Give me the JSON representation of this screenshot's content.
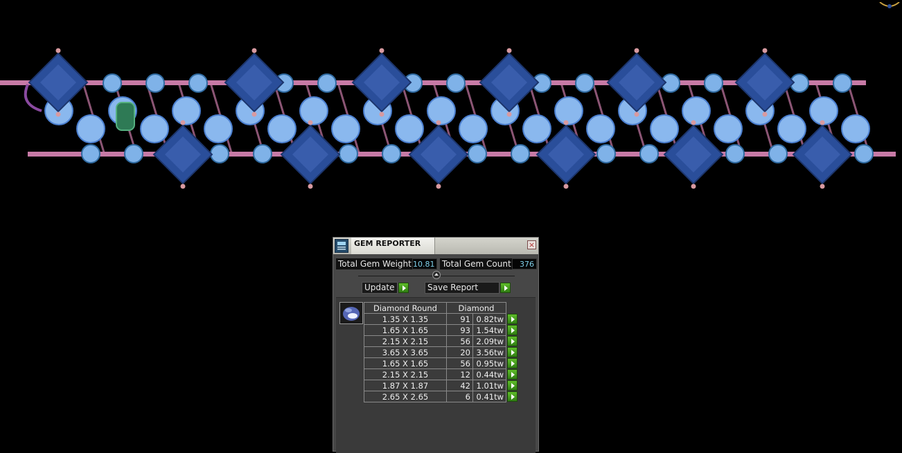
{
  "window": {
    "title": "GEM REPORTER"
  },
  "summary": {
    "total_weight_label": "Total Gem Weight",
    "total_weight_value": "10.81",
    "total_count_label": "Total Gem Count",
    "total_count_value": "376"
  },
  "actions": {
    "update_label": "Update",
    "save_report_label": "Save Report"
  },
  "gem_table": {
    "headers": {
      "shape": "Diamond Round",
      "type": "Diamond"
    },
    "rows": [
      {
        "size": "1.35 X 1.35",
        "count": "91",
        "weight": "0.82tw"
      },
      {
        "size": "1.65 X 1.65",
        "count": "93",
        "weight": "1.54tw"
      },
      {
        "size": "2.15 X 2.15",
        "count": "56",
        "weight": "2.09tw"
      },
      {
        "size": "3.65 X 3.65",
        "count": "20",
        "weight": "3.56tw"
      },
      {
        "size": "1.65 X 1.65",
        "count": "56",
        "weight": "0.95tw"
      },
      {
        "size": "2.15 X 2.15",
        "count": "12",
        "weight": "0.44tw"
      },
      {
        "size": "1.87 X 1.87",
        "count": "42",
        "weight": "1.01tw"
      },
      {
        "size": "2.65 X 2.65",
        "count": "6",
        "weight": "0.41tw"
      }
    ]
  },
  "colors": {
    "background": "#000000",
    "panel": "#474747",
    "value_text": "#7fd0ea",
    "go_button": "#3f9a1a",
    "sapphire": "#2a4e9a",
    "diamond": "#7fb2e8",
    "metal_pink": "#c77aa6",
    "metal_purple": "#8a4aa0"
  },
  "icons": [
    "app-icon",
    "close-icon",
    "collapse-icon",
    "play-arrow-icon",
    "gem-thumbnail-icon"
  ]
}
